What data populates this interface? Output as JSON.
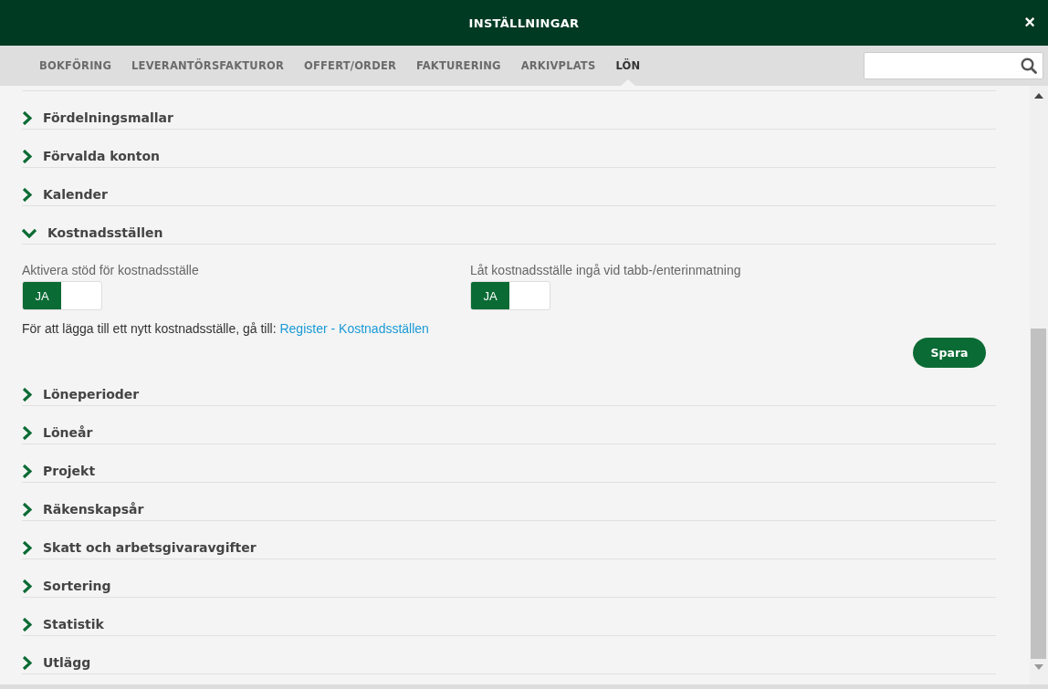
{
  "window": {
    "title": "INSTÄLLNINGAR",
    "close": "×"
  },
  "tabs": [
    {
      "label": "BOKFÖRING",
      "selected": false
    },
    {
      "label": "LEVERANTÖRSFAKTUROR",
      "selected": false
    },
    {
      "label": "OFFERT/ORDER",
      "selected": false
    },
    {
      "label": "FAKTURERING",
      "selected": false
    },
    {
      "label": "ARKIVPLATS",
      "selected": false
    },
    {
      "label": "LÖN",
      "selected": true
    }
  ],
  "sections": [
    {
      "title": "Fördelningsmallar",
      "expanded": false
    },
    {
      "title": "Förvalda konton",
      "expanded": false
    },
    {
      "title": "Kalender",
      "expanded": false
    },
    {
      "title": "Kostnadsställen",
      "expanded": true,
      "settings": [
        {
          "label": "Aktivera stöd för kostnadsställe",
          "toggle": "JA",
          "on": true
        },
        {
          "label": "Låt kostnadsställe ingå vid tabb-/enterinmatning",
          "toggle": "JA",
          "on": true
        }
      ],
      "note": "För att lägga till ett nytt kostnadsställe, gå till:",
      "link": "Register - Kostnadsställen",
      "button": "Spara"
    },
    {
      "title": "Löneperioder",
      "expanded": false
    },
    {
      "title": "Löneår",
      "expanded": false
    },
    {
      "title": "Projekt",
      "expanded": false
    },
    {
      "title": "Räkenskapsår",
      "expanded": false
    },
    {
      "title": "Skatt och arbetsgivaravgifter",
      "expanded": false
    },
    {
      "title": "Sortering",
      "expanded": false
    },
    {
      "title": "Statistik",
      "expanded": false
    },
    {
      "title": "Utlägg",
      "expanded": false
    }
  ]
}
